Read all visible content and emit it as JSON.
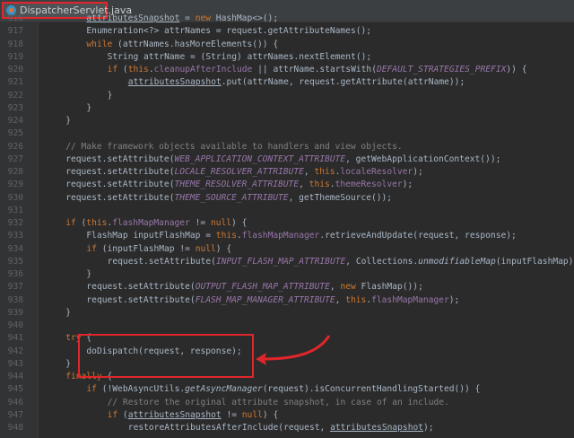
{
  "tab": {
    "label": "DispatcherServlet.java",
    "icon": "java-class-icon"
  },
  "colors": {
    "background": "#2b2b2b",
    "keyword": "#cc7832",
    "field": "#9876aa",
    "comment": "#808080",
    "highlight_box": "#e0262a"
  },
  "lines": [
    {
      "num": "916",
      "indent": 4,
      "tokens": [
        [
          "ul",
          "attributesSnapshot"
        ],
        [
          "p",
          " = "
        ],
        [
          "kw",
          "new "
        ],
        [
          "p",
          "HashMap<>();"
        ]
      ]
    },
    {
      "num": "917",
      "indent": 4,
      "tokens": [
        [
          "p",
          "Enumeration<?> attrNames = request.getAttributeNames();"
        ]
      ]
    },
    {
      "num": "918",
      "indent": 4,
      "tokens": [
        [
          "kw",
          "while "
        ],
        [
          "p",
          "(attrNames.hasMoreElements()) {"
        ]
      ]
    },
    {
      "num": "919",
      "indent": 6,
      "tokens": [
        [
          "p",
          "String attrName = (String) attrNames.nextElement();"
        ]
      ]
    },
    {
      "num": "920",
      "indent": 6,
      "tokens": [
        [
          "kw",
          "if "
        ],
        [
          "p",
          "("
        ],
        [
          "kw",
          "this"
        ],
        [
          "p",
          "."
        ],
        [
          "fld",
          "cleanupAfterInclude"
        ],
        [
          "p",
          " || attrName.startsWith("
        ],
        [
          "sfld",
          "DEFAULT_STRATEGIES_PREFIX"
        ],
        [
          "p",
          ")) {"
        ]
      ]
    },
    {
      "num": "921",
      "indent": 8,
      "tokens": [
        [
          "ul",
          "attributesSnapshot"
        ],
        [
          "p",
          ".put(attrName, request.getAttribute(attrName));"
        ]
      ]
    },
    {
      "num": "922",
      "indent": 6,
      "tokens": [
        [
          "p",
          "}"
        ]
      ]
    },
    {
      "num": "923",
      "indent": 4,
      "tokens": [
        [
          "p",
          "}"
        ]
      ]
    },
    {
      "num": "924",
      "indent": 2,
      "tokens": [
        [
          "p",
          "}"
        ]
      ]
    },
    {
      "num": "925",
      "indent": 0,
      "tokens": []
    },
    {
      "num": "926",
      "indent": 2,
      "tokens": [
        [
          "cm",
          "// Make framework objects available to handlers and view objects."
        ]
      ]
    },
    {
      "num": "927",
      "indent": 2,
      "tokens": [
        [
          "p",
          "request.setAttribute("
        ],
        [
          "sfld",
          "WEB_APPLICATION_CONTEXT_ATTRIBUTE"
        ],
        [
          "p",
          ", getWebApplicationContext());"
        ]
      ]
    },
    {
      "num": "928",
      "indent": 2,
      "tokens": [
        [
          "p",
          "request.setAttribute("
        ],
        [
          "sfld",
          "LOCALE_RESOLVER_ATTRIBUTE"
        ],
        [
          "p",
          ", "
        ],
        [
          "kw",
          "this"
        ],
        [
          "p",
          "."
        ],
        [
          "fld",
          "localeResolver"
        ],
        [
          "p",
          ");"
        ]
      ]
    },
    {
      "num": "929",
      "indent": 2,
      "tokens": [
        [
          "p",
          "request.setAttribute("
        ],
        [
          "sfld",
          "THEME_RESOLVER_ATTRIBUTE"
        ],
        [
          "p",
          ", "
        ],
        [
          "kw",
          "this"
        ],
        [
          "p",
          "."
        ],
        [
          "fld",
          "themeResolver"
        ],
        [
          "p",
          ");"
        ]
      ]
    },
    {
      "num": "930",
      "indent": 2,
      "tokens": [
        [
          "p",
          "request.setAttribute("
        ],
        [
          "sfld",
          "THEME_SOURCE_ATTRIBUTE"
        ],
        [
          "p",
          ", getThemeSource());"
        ]
      ]
    },
    {
      "num": "931",
      "indent": 0,
      "tokens": []
    },
    {
      "num": "932",
      "indent": 2,
      "tokens": [
        [
          "kw",
          "if "
        ],
        [
          "p",
          "("
        ],
        [
          "kw",
          "this"
        ],
        [
          "p",
          "."
        ],
        [
          "fld",
          "flashMapManager"
        ],
        [
          "p",
          " != "
        ],
        [
          "kw",
          "null"
        ],
        [
          "p",
          ") {"
        ]
      ]
    },
    {
      "num": "933",
      "indent": 4,
      "tokens": [
        [
          "p",
          "FlashMap inputFlashMap = "
        ],
        [
          "kw",
          "this"
        ],
        [
          "p",
          "."
        ],
        [
          "fld",
          "flashMapManager"
        ],
        [
          "p",
          ".retrieveAndUpdate(request, response);"
        ]
      ]
    },
    {
      "num": "934",
      "indent": 4,
      "tokens": [
        [
          "kw",
          "if "
        ],
        [
          "p",
          "(inputFlashMap != "
        ],
        [
          "kw",
          "null"
        ],
        [
          "p",
          ") {"
        ]
      ]
    },
    {
      "num": "935",
      "indent": 6,
      "tokens": [
        [
          "p",
          "request.setAttribute("
        ],
        [
          "sfld",
          "INPUT_FLASH_MAP_ATTRIBUTE"
        ],
        [
          "p",
          ", Collections."
        ],
        [
          "it",
          "unmodifiableMap"
        ],
        [
          "p",
          "(inputFlashMap));"
        ]
      ]
    },
    {
      "num": "936",
      "indent": 4,
      "tokens": [
        [
          "p",
          "}"
        ]
      ]
    },
    {
      "num": "937",
      "indent": 4,
      "tokens": [
        [
          "p",
          "request.setAttribute("
        ],
        [
          "sfld",
          "OUTPUT_FLASH_MAP_ATTRIBUTE"
        ],
        [
          "p",
          ", "
        ],
        [
          "kw",
          "new "
        ],
        [
          "p",
          "FlashMap());"
        ]
      ]
    },
    {
      "num": "938",
      "indent": 4,
      "tokens": [
        [
          "p",
          "request.setAttribute("
        ],
        [
          "sfld",
          "FLASH_MAP_MANAGER_ATTRIBUTE"
        ],
        [
          "p",
          ", "
        ],
        [
          "kw",
          "this"
        ],
        [
          "p",
          "."
        ],
        [
          "fld",
          "flashMapManager"
        ],
        [
          "p",
          ");"
        ]
      ]
    },
    {
      "num": "939",
      "indent": 2,
      "tokens": [
        [
          "p",
          "}"
        ]
      ]
    },
    {
      "num": "940",
      "indent": 0,
      "tokens": []
    },
    {
      "num": "941",
      "indent": 2,
      "tokens": [
        [
          "kw",
          "try "
        ],
        [
          "p",
          "{"
        ]
      ]
    },
    {
      "num": "942",
      "indent": 4,
      "tokens": [
        [
          "p",
          "doDispatch(request, response);"
        ]
      ]
    },
    {
      "num": "943",
      "indent": 2,
      "tokens": [
        [
          "p",
          "}"
        ]
      ]
    },
    {
      "num": "944",
      "indent": 2,
      "tokens": [
        [
          "kw",
          "finally "
        ],
        [
          "p",
          "{"
        ]
      ]
    },
    {
      "num": "945",
      "indent": 4,
      "tokens": [
        [
          "kw",
          "if "
        ],
        [
          "p",
          "(!WebAsyncUtils."
        ],
        [
          "it",
          "getAsyncManager"
        ],
        [
          "p",
          "(request).isConcurrentHandlingStarted()) {"
        ]
      ]
    },
    {
      "num": "946",
      "indent": 6,
      "tokens": [
        [
          "cm",
          "// Restore the original attribute snapshot, in case of an include."
        ]
      ]
    },
    {
      "num": "947",
      "indent": 6,
      "tokens": [
        [
          "kw",
          "if "
        ],
        [
          "p",
          "("
        ],
        [
          "ul",
          "attributesSnapshot"
        ],
        [
          "p",
          " != "
        ],
        [
          "kw",
          "null"
        ],
        [
          "p",
          ") {"
        ]
      ]
    },
    {
      "num": "948",
      "indent": 8,
      "tokens": [
        [
          "p",
          "restoreAttributesAfterInclude(request, "
        ],
        [
          "ul",
          "attributesSnapshot"
        ],
        [
          "p",
          ");"
        ]
      ]
    }
  ]
}
